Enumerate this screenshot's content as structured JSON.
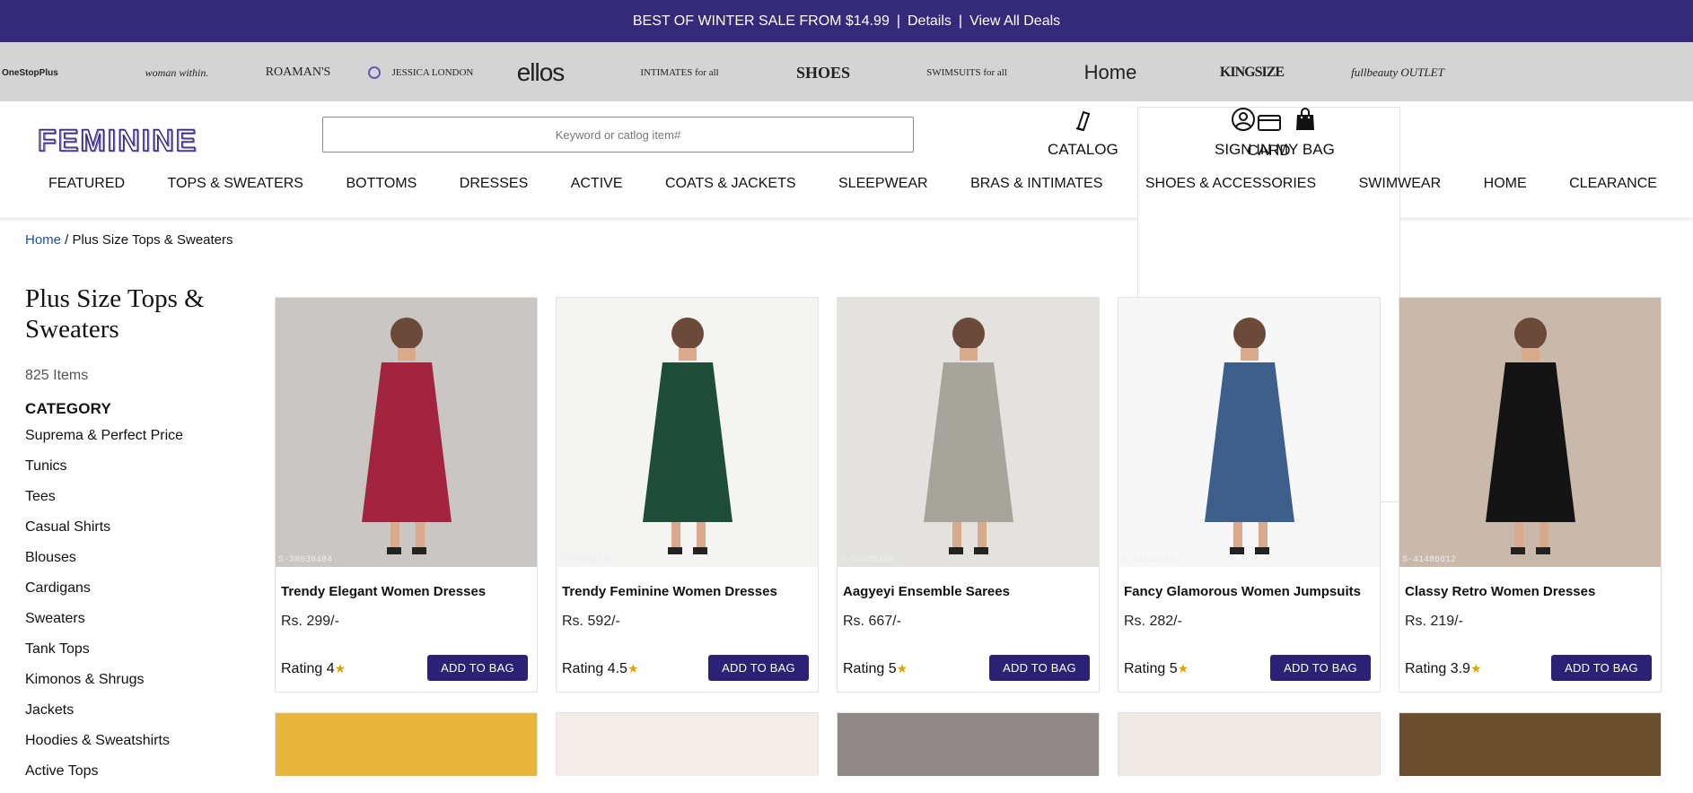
{
  "promo": {
    "text": "BEST OF WINTER SALE FROM $14.99",
    "sep": "|",
    "details": "Details",
    "view_all": "View All Deals"
  },
  "brands": {
    "onestopplus": "OneStopPlus",
    "woman_within": "woman within.",
    "roamans": "ROAMAN'S",
    "jessica_london": "JESSICA LONDON",
    "ellos": "ellos",
    "intimates": "INTIMATES for all",
    "shoes": "SHOES",
    "swimsuits": "SWIMSUITS for all",
    "brylane": "Home",
    "kingsize": "KINGSIZE",
    "fullbeauty": "fullbeauty OUTLET"
  },
  "header": {
    "logo_text": "FEMININE",
    "search_placeholder": "Keyword or catlog item#",
    "catalog": "CATALOG",
    "card": "CARD",
    "sign_in": "SIGN IN",
    "my_bag": "MY BAG"
  },
  "nav": [
    "FEATURED",
    "TOPS & SWEATERS",
    "BOTTOMS",
    "DRESSES",
    "ACTIVE",
    "COATS & JACKETS",
    "SLEEPWEAR",
    "BRAS & INTIMATES",
    "SHOES & ACCESSORIES",
    "SWIMWEAR",
    "HOME",
    "CLEARANCE"
  ],
  "breadcrumb": {
    "home": "Home",
    "sep": " / ",
    "current": "Plus Size Tops & Sweaters"
  },
  "sidebar": {
    "title": "Plus Size Tops & Sweaters",
    "count": "825 Items",
    "category_title": "CATEGORY",
    "categories": [
      "Suprema & Perfect Price",
      "Tunics",
      "Tees",
      "Casual Shirts",
      "Blouses",
      "Cardigans",
      "Sweaters",
      "Tank Tops",
      "Kimonos & Shrugs",
      "Jackets",
      "Hoodies & Sweatshirts",
      "Active Tops"
    ]
  },
  "products": [
    {
      "name": "Trendy Elegant Women Dresses",
      "price": "Rs. 299/-",
      "rating": "Rating 4",
      "star": "★",
      "sku": "S-38038484",
      "button": "ADD TO BAG",
      "bg": "#c9c6c4",
      "color": "#a3243f"
    },
    {
      "name": "Trendy Feminine Women Dresses",
      "price": "Rs. 592/-",
      "rating": "Rating 4.5",
      "star": "★",
      "sku": "S-36843549",
      "button": "ADD TO BAG",
      "bg": "#f4f4f2",
      "color": "#1e4e3a"
    },
    {
      "name": "Aagyeyi Ensemble Sarees",
      "price": "Rs. 667/-",
      "rating": "Rating 5",
      "star": "★",
      "sku": "S-66485169",
      "button": "ADD TO BAG",
      "bg": "#e3e2df",
      "color": "#a7a49c"
    },
    {
      "name": "Fancy Glamorous Women Jumpsuits",
      "price": "Rs. 282/-",
      "rating": "Rating 5",
      "star": "★",
      "sku": "S-32043183",
      "button": "ADD TO BAG",
      "bg": "#f7f7f7",
      "color": "#3e5f8c"
    },
    {
      "name": "Classy Retro Women Dresses",
      "price": "Rs. 219/-",
      "rating": "Rating 3.9",
      "star": "★",
      "sku": "S-41486612",
      "button": "ADD TO BAG",
      "bg": "#c8b9ab",
      "color": "#141414"
    }
  ],
  "partial_row_colors": [
    "#e8b63a",
    "#f3ece8",
    "#8f8a87",
    "#efe8e4",
    "#6a4e2e"
  ]
}
